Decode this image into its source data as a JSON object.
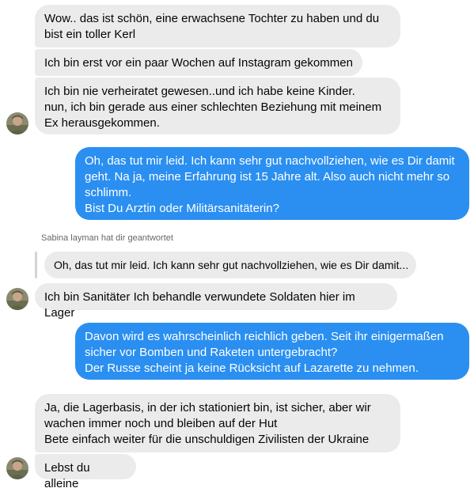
{
  "messages": [
    {
      "text": "Wow.. das ist schön, eine erwachsene Tochter zu haben und du\nbist ein toller Kerl"
    },
    {
      "text": "Ich bin erst vor ein paar Wochen auf Instagram gekommen"
    },
    {
      "text": "Ich bin nie verheiratet gewesen..und ich habe keine Kinder.\nnun, ich bin gerade aus einer schlechten Beziehung mit meinem\nEx herausgekommen."
    },
    {
      "text": "Oh, das tut mir leid. Ich kann sehr gut nachvollziehen, wie es Dir damit\ngeht. Na ja, meine Erfahrung ist 15 Jahre alt. Also auch nicht mehr so\nschlimm.\nBist Du Arztin oder Militärsanitäterin?"
    },
    {
      "text": "Ich bin Sanitäter Ich behandle verwundete Soldaten hier im Lager"
    },
    {
      "text": "Davon wird es wahrscheinlich reichlich geben. Seit ihr einigermaßen\nsicher vor Bomben und Raketen untergebracht?\nDer Russe scheint ja keine Rücksicht auf Lazarette zu nehmen."
    },
    {
      "text": "Ja, die Lagerbasis, in der ich stationiert bin, ist sicher, aber wir\nwachen immer noch und bleiben auf der Hut\nBete einfach weiter für die unschuldigen Zivilisten der Ukraine"
    },
    {
      "text": "Lebst du alleine"
    }
  ],
  "reply": {
    "label": "Sabina layman hat dir geantwortet",
    "quote": "Oh, das tut mir leid. Ich kann sehr gut nachvollziehen, wie es Dir damit..."
  },
  "icons": {
    "avatar": "user-avatar-photo"
  },
  "colors": {
    "incoming_bubble": "#ebebeb",
    "outgoing_bubble": "#2a8ff1",
    "outgoing_text": "#ffffff",
    "meta_text": "#65676b"
  }
}
